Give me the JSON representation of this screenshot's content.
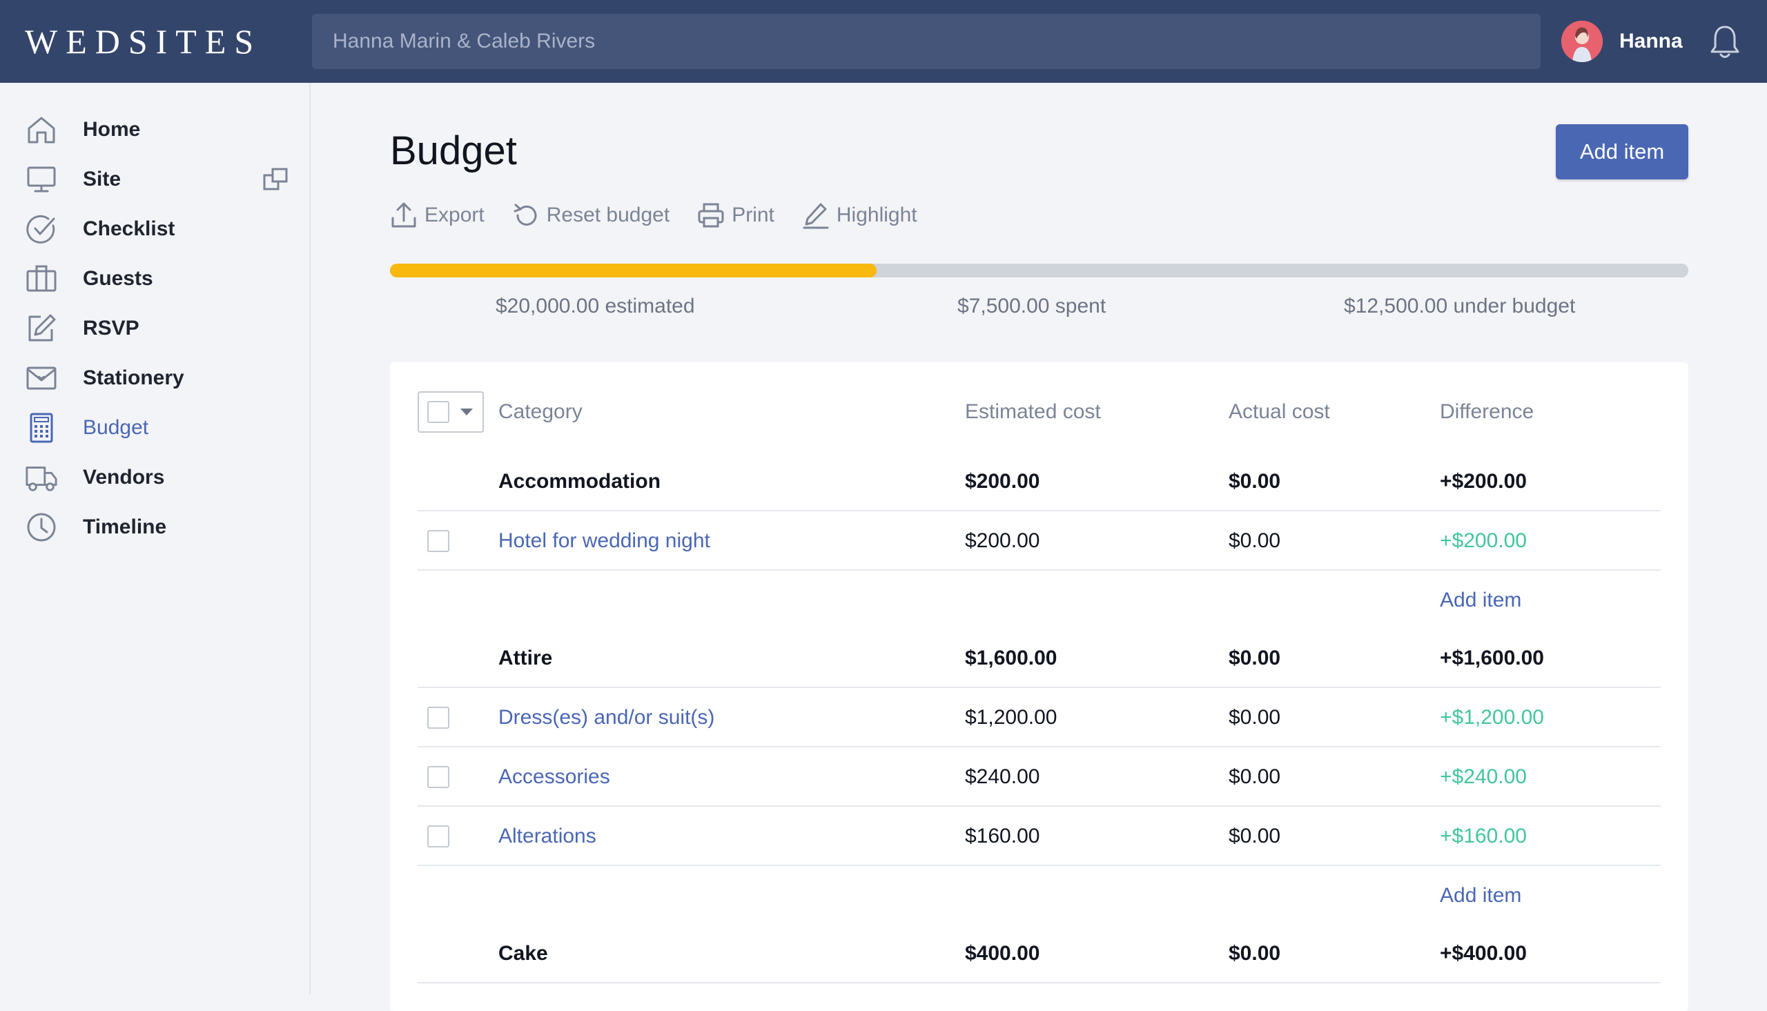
{
  "app": {
    "logo": "WEDSITES"
  },
  "search": {
    "value": "Hanna Marin & Caleb Rivers"
  },
  "user": {
    "name": "Hanna"
  },
  "sidebar": {
    "items": [
      {
        "label": "Home",
        "icon": "home-icon"
      },
      {
        "label": "Site",
        "icon": "monitor-icon"
      },
      {
        "label": "Checklist",
        "icon": "check-circle-icon"
      },
      {
        "label": "Guests",
        "icon": "guests-icon"
      },
      {
        "label": "RSVP",
        "icon": "edit-icon"
      },
      {
        "label": "Stationery",
        "icon": "envelope-icon"
      },
      {
        "label": "Budget",
        "icon": "calculator-icon",
        "active": true
      },
      {
        "label": "Vendors",
        "icon": "truck-icon"
      },
      {
        "label": "Timeline",
        "icon": "clock-icon"
      }
    ]
  },
  "page": {
    "title": "Budget",
    "add_button": "Add item"
  },
  "toolbar": {
    "export": "Export",
    "reset": "Reset budget",
    "print": "Print",
    "highlight": "Highlight"
  },
  "progress": {
    "fraction": 0.375
  },
  "summary": {
    "estimated": "$20,000.00 estimated",
    "spent": "$7,500.00 spent",
    "under": "$12,500.00 under budget"
  },
  "table": {
    "headers": {
      "category": "Category",
      "estimated": "Estimated cost",
      "actual": "Actual cost",
      "difference": "Difference"
    },
    "groups": [
      {
        "category": "Accommodation",
        "estimated": "$200.00",
        "actual": "$0.00",
        "difference": "+$200.00",
        "items": [
          {
            "name": "Hotel for wedding night",
            "estimated": "$200.00",
            "actual": "$0.00",
            "difference": "+$200.00"
          }
        ],
        "add_label": "Add item"
      },
      {
        "category": "Attire",
        "estimated": "$1,600.00",
        "actual": "$0.00",
        "difference": "+$1,600.00",
        "items": [
          {
            "name": "Dress(es) and/or suit(s)",
            "estimated": "$1,200.00",
            "actual": "$0.00",
            "difference": "+$1,200.00"
          },
          {
            "name": "Accessories",
            "estimated": "$240.00",
            "actual": "$0.00",
            "difference": "+$240.00"
          },
          {
            "name": "Alterations",
            "estimated": "$160.00",
            "actual": "$0.00",
            "difference": "+$160.00"
          }
        ],
        "add_label": "Add item"
      },
      {
        "category": "Cake",
        "estimated": "$400.00",
        "actual": "$0.00",
        "difference": "+$400.00"
      }
    ]
  },
  "colors": {
    "topbar": "#34456b",
    "accent": "#4a67b4",
    "progress": "#f9b80e",
    "positive": "#43c59e"
  }
}
